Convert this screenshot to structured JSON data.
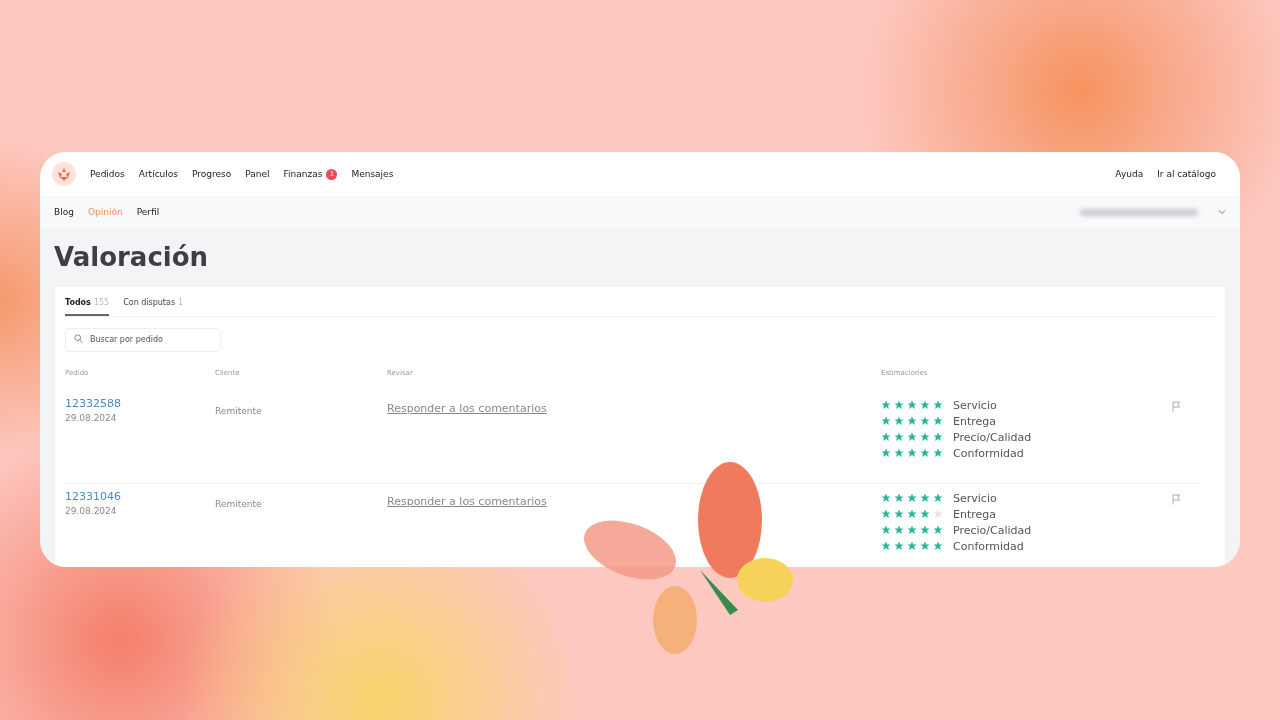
{
  "top_nav": {
    "items": [
      {
        "label": "Pedidos"
      },
      {
        "label": "Artículos"
      },
      {
        "label": "Progreso"
      },
      {
        "label": "Panel"
      },
      {
        "label": "Finanzas",
        "badge": "1"
      },
      {
        "label": "Mensajes"
      }
    ],
    "right_links": [
      "Ayuda",
      "Ir al catálogo"
    ]
  },
  "sub_nav": {
    "items": [
      {
        "label": "Blog",
        "selected": false
      },
      {
        "label": "Opinión",
        "selected": true
      },
      {
        "label": "Perfil",
        "selected": false
      }
    ]
  },
  "page_title": "Valoración",
  "tabs": [
    {
      "label": "Todos",
      "count": "155",
      "selected": true
    },
    {
      "label": "Con disputas",
      "count": "1",
      "selected": false
    }
  ],
  "search": {
    "placeholder": "Buscar por pedido"
  },
  "table": {
    "columns": [
      "Pedido",
      "Cliente",
      "Revisar",
      "Estimaciones"
    ],
    "rows": [
      {
        "order": "12332588",
        "date": "29.08.2024",
        "client": "Remitente",
        "action": "Responder a los comentarios",
        "ratings": [
          {
            "label": "Servicio",
            "stars": 5
          },
          {
            "label": "Entrega",
            "stars": 5
          },
          {
            "label": "Precio/Calidad",
            "stars": 5
          },
          {
            "label": "Conformidad",
            "stars": 5
          }
        ]
      },
      {
        "order": "12331046",
        "date": "29.08.2024",
        "client": "Remitente",
        "action": "Responder a los comentarios",
        "ratings": [
          {
            "label": "Servicio",
            "stars": 5
          },
          {
            "label": "Entrega",
            "stars": 4
          },
          {
            "label": "Precio/Calidad",
            "stars": 5
          },
          {
            "label": "Conformidad",
            "stars": 5
          }
        ]
      }
    ]
  }
}
